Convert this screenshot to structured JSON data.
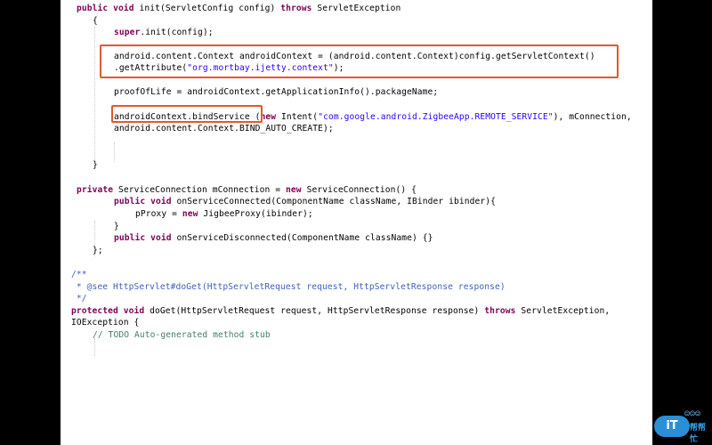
{
  "code_lines": [
    [
      [
        "kw",
        "public"
      ],
      [
        "t",
        " "
      ],
      [
        "kw",
        "void"
      ],
      [
        "t",
        " init(ServletConfig config) "
      ],
      [
        "kw",
        "throws"
      ],
      [
        "t",
        " ServletException"
      ]
    ],
    [
      [
        "t",
        "{"
      ]
    ],
    [
      [
        "kw",
        "super"
      ],
      [
        "t",
        ".init(config);"
      ]
    ],
    [
      [
        "t",
        "android.content.Context androidContext = (android.content.Context)config.getServletContext()"
      ]
    ],
    [
      [
        "t",
        ".getAttribute("
      ],
      [
        "str",
        "\"org.mortbay.ijetty.context\""
      ],
      [
        "t",
        ");"
      ]
    ],
    [
      [
        "t",
        "proofOfLife = androidContext.getApplicationInfo().packageName;"
      ]
    ],
    [
      [
        "t",
        "androidContext.bindService ("
      ],
      [
        "kw",
        "new"
      ],
      [
        "t",
        " Intent("
      ],
      [
        "str",
        "\"com.google.android.ZigbeeApp.REMOTE_SERVICE\""
      ],
      [
        "t",
        "), mConnection,"
      ]
    ],
    [
      [
        "t",
        "android.content.Context.BIND_AUTO_CREATE);"
      ]
    ],
    [
      [
        "t",
        "}"
      ]
    ],
    [
      [
        "kw",
        "private"
      ],
      [
        "t",
        " ServiceConnection mConnection = "
      ],
      [
        "kw",
        "new"
      ],
      [
        "t",
        " ServiceConnection() {"
      ]
    ],
    [
      [
        "kw",
        "public"
      ],
      [
        "t",
        " "
      ],
      [
        "kw",
        "void"
      ],
      [
        "t",
        " onServiceConnected(ComponentName className, IBinder ibinder){"
      ]
    ],
    [
      [
        "t",
        "pProxy = "
      ],
      [
        "kw",
        "new"
      ],
      [
        "t",
        " JigbeeProxy(ibinder);"
      ]
    ],
    [
      [
        "t",
        "}"
      ]
    ],
    [
      [
        "kw",
        "public"
      ],
      [
        "t",
        " "
      ],
      [
        "kw",
        "void"
      ],
      [
        "t",
        " onServiceDisconnected(ComponentName className) {}"
      ]
    ],
    [
      [
        "t",
        "};"
      ]
    ],
    [
      [
        "jd",
        "/**"
      ]
    ],
    [
      [
        "jd",
        " * @see HttpServlet#doGet(HttpServletRequest request, HttpServletResponse response)"
      ]
    ],
    [
      [
        "jd",
        " */"
      ]
    ],
    [
      [
        "kw",
        "protected"
      ],
      [
        "t",
        " "
      ],
      [
        "kw",
        "void"
      ],
      [
        "t",
        " doGet(HttpServletRequest request, HttpServletResponse response) "
      ],
      [
        "kw",
        "throws"
      ],
      [
        "t",
        " ServletException,"
      ]
    ],
    [
      [
        "t",
        "IOException {"
      ]
    ],
    [
      [
        "cmt",
        "// TODO Auto-generated method stub"
      ]
    ]
  ],
  "watermark": {
    "badge": "iT",
    "text": "帮帮忙"
  },
  "highlight_color": "#e05a2a"
}
